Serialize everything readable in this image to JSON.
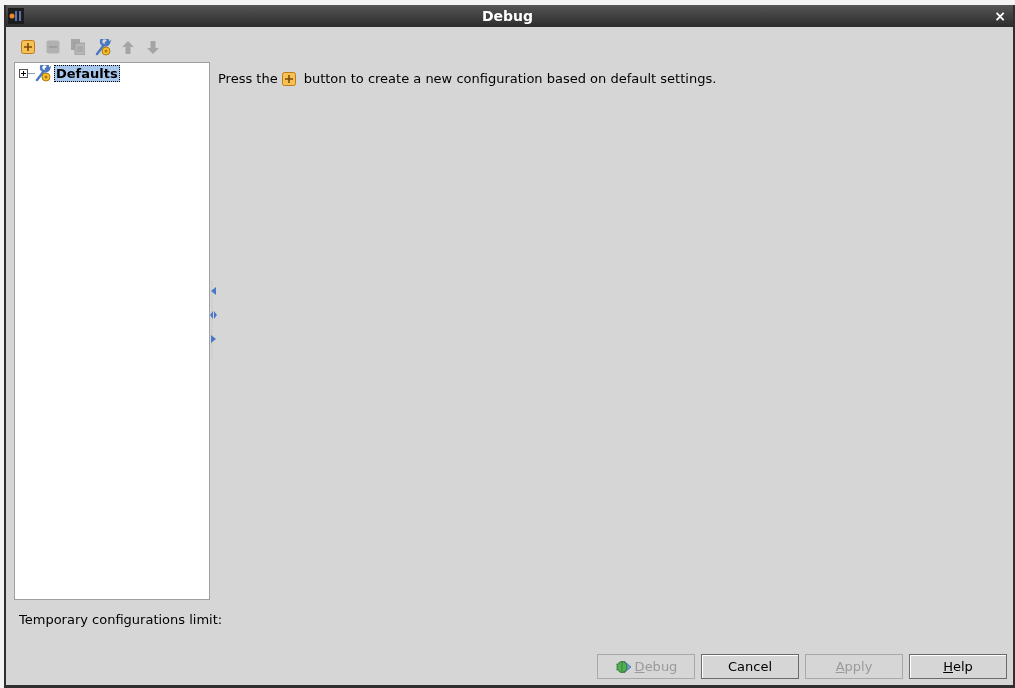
{
  "window": {
    "title": "Debug",
    "close": "×"
  },
  "toolbar": [
    {
      "kind": "add",
      "disabled": false
    },
    {
      "kind": "remove",
      "disabled": true
    },
    {
      "kind": "copy",
      "disabled": true
    },
    {
      "kind": "defaults",
      "disabled": false
    },
    {
      "kind": "up",
      "disabled": true
    },
    {
      "kind": "down",
      "disabled": true
    }
  ],
  "tree": [
    {
      "label": "Defaults",
      "expanded": false,
      "selected": true
    }
  ],
  "hint": {
    "before": "Press the",
    "after": "button to create a new configuration based on default settings."
  },
  "limit_label": "Temporary configurations limit:",
  "buttons": [
    {
      "kind": "debug",
      "mnemonic": "D",
      "rest": "ebug",
      "disabled": true
    },
    {
      "kind": "plain",
      "rest": "Cancel",
      "disabled": false
    },
    {
      "kind": "plain",
      "mnemonic": "A",
      "rest": "pply",
      "disabled": true
    },
    {
      "kind": "plain",
      "mnemonic": "H",
      "rest": "elp",
      "disabled": false
    }
  ]
}
